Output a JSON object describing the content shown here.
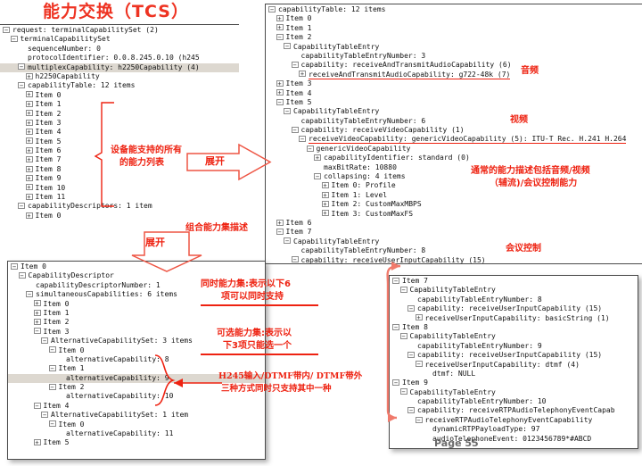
{
  "title": "能力交换（TCS）",
  "page_label": "Page 55",
  "panels": {
    "top_left": {
      "name": "terminal-capability-set-tree",
      "rows": [
        {
          "indent": 0,
          "toggle": "minus",
          "text": "request: terminalCapabilitySet (2)"
        },
        {
          "indent": 1,
          "toggle": "minus",
          "text": "terminalCapabilitySet"
        },
        {
          "indent": 2,
          "toggle": "none",
          "text": "sequenceNumber: 0"
        },
        {
          "indent": 2,
          "toggle": "none",
          "text": "protocolIdentifier: 0.0.8.245.0.10 (h245"
        },
        {
          "indent": 2,
          "toggle": "minus",
          "text": "multiplexCapability: h2250Capability (4)",
          "selected": true
        },
        {
          "indent": 3,
          "toggle": "plus",
          "text": "h2250Capability"
        },
        {
          "indent": 2,
          "toggle": "minus",
          "text": "capabilityTable: 12 items"
        },
        {
          "indent": 3,
          "toggle": "plus",
          "text": "Item 0"
        },
        {
          "indent": 3,
          "toggle": "plus",
          "text": "Item 1"
        },
        {
          "indent": 3,
          "toggle": "plus",
          "text": "Item 2"
        },
        {
          "indent": 3,
          "toggle": "plus",
          "text": "Item 3"
        },
        {
          "indent": 3,
          "toggle": "plus",
          "text": "Item 4"
        },
        {
          "indent": 3,
          "toggle": "plus",
          "text": "Item 5"
        },
        {
          "indent": 3,
          "toggle": "plus",
          "text": "Item 6"
        },
        {
          "indent": 3,
          "toggle": "plus",
          "text": "Item 7"
        },
        {
          "indent": 3,
          "toggle": "plus",
          "text": "Item 8"
        },
        {
          "indent": 3,
          "toggle": "plus",
          "text": "Item 9"
        },
        {
          "indent": 3,
          "toggle": "plus",
          "text": "Item 10"
        },
        {
          "indent": 3,
          "toggle": "plus",
          "text": "Item 11"
        },
        {
          "indent": 2,
          "toggle": "minus",
          "text": "capabilityDescriptors: 1 item"
        },
        {
          "indent": 3,
          "toggle": "plus",
          "text": "Item 0"
        }
      ]
    },
    "top_right": {
      "name": "capability-table-tree",
      "rows": [
        {
          "indent": 0,
          "toggle": "minus",
          "text": "capabilityTable: 12 items"
        },
        {
          "indent": 1,
          "toggle": "plus",
          "text": "Item 0"
        },
        {
          "indent": 1,
          "toggle": "plus",
          "text": "Item 1"
        },
        {
          "indent": 1,
          "toggle": "minus",
          "text": "Item 2"
        },
        {
          "indent": 2,
          "toggle": "minus",
          "text": "CapabilityTableEntry"
        },
        {
          "indent": 3,
          "toggle": "none",
          "text": "capabilityTableEntryNumber: 3"
        },
        {
          "indent": 3,
          "toggle": "minus",
          "text": "capability: receiveAndTransmitAudioCapability (6)"
        },
        {
          "indent": 4,
          "toggle": "plus",
          "text": "receiveAndTransmitAudioCapability: g722-48k (7)",
          "underline": true
        },
        {
          "indent": 1,
          "toggle": "plus",
          "text": "Item 3"
        },
        {
          "indent": 1,
          "toggle": "plus",
          "text": "Item 4"
        },
        {
          "indent": 1,
          "toggle": "minus",
          "text": "Item 5"
        },
        {
          "indent": 2,
          "toggle": "minus",
          "text": "CapabilityTableEntry"
        },
        {
          "indent": 3,
          "toggle": "none",
          "text": "capabilityTableEntryNumber: 6"
        },
        {
          "indent": 3,
          "toggle": "minus",
          "text": "capability: receiveVideoCapability (1)"
        },
        {
          "indent": 4,
          "toggle": "minus",
          "text": "receiveVideoCapability: genericVideoCapability (5): ITU-T Rec. H.241 H.264",
          "underline": true
        },
        {
          "indent": 5,
          "toggle": "minus",
          "text": "genericVideoCapability"
        },
        {
          "indent": 6,
          "toggle": "plus",
          "text": "capabilityIdentifier: standard (0)"
        },
        {
          "indent": 6,
          "toggle": "none",
          "text": "maxBitRate: 10880"
        },
        {
          "indent": 6,
          "toggle": "minus",
          "text": "collapsing: 4 items"
        },
        {
          "indent": 7,
          "toggle": "plus",
          "text": "Item 0: Profile"
        },
        {
          "indent": 7,
          "toggle": "plus",
          "text": "Item 1: Level"
        },
        {
          "indent": 7,
          "toggle": "plus",
          "text": "Item 2: CustomMaxMBPS"
        },
        {
          "indent": 7,
          "toggle": "plus",
          "text": "Item 3: CustomMaxFS"
        },
        {
          "indent": 1,
          "toggle": "plus",
          "text": "Item 6"
        },
        {
          "indent": 1,
          "toggle": "minus",
          "text": "Item 7"
        },
        {
          "indent": 2,
          "toggle": "minus",
          "text": "CapabilityTableEntry"
        },
        {
          "indent": 3,
          "toggle": "none",
          "text": "capabilityTableEntryNumber: 8"
        },
        {
          "indent": 3,
          "toggle": "minus",
          "text": "capability: receiveUserInputCapability (15)"
        },
        {
          "indent": 4,
          "toggle": "plus",
          "text": "receiveUserInputCapability: basicString (1)",
          "underline": true
        }
      ]
    },
    "bottom_left": {
      "name": "capability-descriptor-tree",
      "rows": [
        {
          "indent": 0,
          "toggle": "minus",
          "text": "Item 0"
        },
        {
          "indent": 1,
          "toggle": "minus",
          "text": "CapabilityDescriptor"
        },
        {
          "indent": 2,
          "toggle": "none",
          "text": "capabilityDescriptorNumber: 1"
        },
        {
          "indent": 2,
          "toggle": "minus",
          "text": "simultaneousCapabilities: 6 items"
        },
        {
          "indent": 3,
          "toggle": "plus",
          "text": "Item 0"
        },
        {
          "indent": 3,
          "toggle": "plus",
          "text": "Item 1"
        },
        {
          "indent": 3,
          "toggle": "plus",
          "text": "Item 2"
        },
        {
          "indent": 3,
          "toggle": "minus",
          "text": "Item 3"
        },
        {
          "indent": 4,
          "toggle": "minus",
          "text": "AlternativeCapabilitySet: 3 items"
        },
        {
          "indent": 5,
          "toggle": "minus",
          "text": "Item 0"
        },
        {
          "indent": 6,
          "toggle": "none",
          "text": "alternativeCapability: 8"
        },
        {
          "indent": 5,
          "toggle": "minus",
          "text": "Item 1"
        },
        {
          "indent": 6,
          "toggle": "none",
          "text": "alternativeCapability: 9",
          "selected": true
        },
        {
          "indent": 5,
          "toggle": "minus",
          "text": "Item 2"
        },
        {
          "indent": 6,
          "toggle": "none",
          "text": "alternativeCapability: 10"
        },
        {
          "indent": 3,
          "toggle": "minus",
          "text": "Item 4"
        },
        {
          "indent": 4,
          "toggle": "minus",
          "text": "AlternativeCapabilitySet: 1 item"
        },
        {
          "indent": 5,
          "toggle": "minus",
          "text": "Item 0"
        },
        {
          "indent": 6,
          "toggle": "none",
          "text": "alternativeCapability: 11"
        },
        {
          "indent": 3,
          "toggle": "plus",
          "text": "Item 5"
        }
      ]
    },
    "bottom_right": {
      "name": "user-input-capability-tree",
      "rows": [
        {
          "indent": 0,
          "toggle": "minus",
          "text": "Item 7"
        },
        {
          "indent": 1,
          "toggle": "minus",
          "text": "CapabilityTableEntry"
        },
        {
          "indent": 2,
          "toggle": "none",
          "text": "capabilityTableEntryNumber: 8"
        },
        {
          "indent": 2,
          "toggle": "minus",
          "text": "capability: receiveUserInputCapability (15)"
        },
        {
          "indent": 3,
          "toggle": "plus",
          "text": "receiveUserInputCapability: basicString (1)"
        },
        {
          "indent": 0,
          "toggle": "minus",
          "text": "Item 8"
        },
        {
          "indent": 1,
          "toggle": "minus",
          "text": "CapabilityTableEntry"
        },
        {
          "indent": 2,
          "toggle": "none",
          "text": "capabilityTableEntryNumber: 9"
        },
        {
          "indent": 2,
          "toggle": "minus",
          "text": "capability: receiveUserInputCapability (15)"
        },
        {
          "indent": 3,
          "toggle": "minus",
          "text": "receiveUserInputCapability: dtmf (4)"
        },
        {
          "indent": 4,
          "toggle": "none",
          "text": "dtmf: NULL"
        },
        {
          "indent": 0,
          "toggle": "minus",
          "text": "Item 9"
        },
        {
          "indent": 1,
          "toggle": "minus",
          "text": "CapabilityTableEntry"
        },
        {
          "indent": 2,
          "toggle": "none",
          "text": "capabilityTableEntryNumber: 10"
        },
        {
          "indent": 2,
          "toggle": "minus",
          "text": "capability: receiveRTPAudioTelephonyEventCapab"
        },
        {
          "indent": 3,
          "toggle": "minus",
          "text": "receiveRTPAudioTelephonyEventCapability"
        },
        {
          "indent": 4,
          "toggle": "none",
          "text": "dynamicRTPPayloadType: 97"
        },
        {
          "indent": 4,
          "toggle": "none",
          "text": "audioTelephoneEvent: 0123456789*#ABCD"
        }
      ]
    }
  },
  "annotations": {
    "capability_list": "设备能支持的所有\n的能力列表",
    "capability_list_l1": "设备能支持的所有",
    "capability_list_l2": "的能力列表",
    "expand_right": "展开",
    "expand_down": "展开",
    "combo_set": "组合能力集描述",
    "audio": "音频",
    "video": "视频",
    "general_desc_l1": "通常的能力描述包括音频/视频",
    "general_desc_l2": "（辅流)/会议控制能力",
    "conference_control": "会议控制",
    "simultaneous_l1": "同时能力集:表示以下6",
    "simultaneous_l2": "项可以同时支持",
    "alternative_l1": "可选能力集:表示以",
    "alternative_l2": "下3项只能选一个",
    "h245_l1": "H245输入/DTMF带内/ DTMF带外",
    "h245_l2": "三种方式同时只支持其中一种"
  },
  "colors": {
    "accent_red": "#ee2211",
    "selection": "#ddd8d0",
    "panel_border": "#4a4a4a"
  }
}
